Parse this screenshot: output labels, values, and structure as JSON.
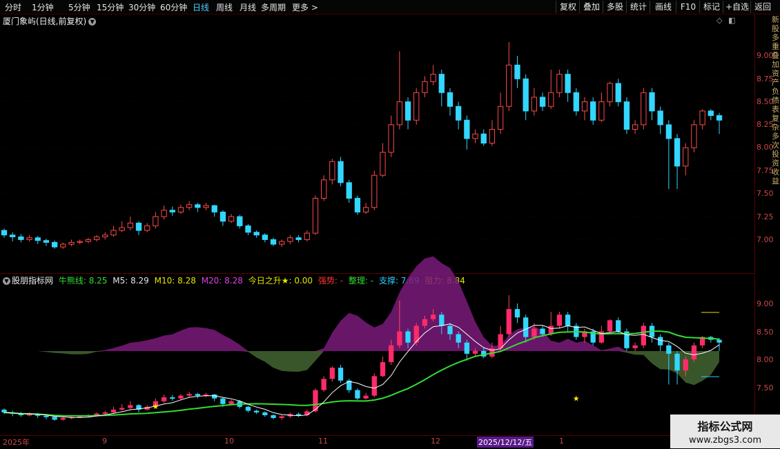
{
  "toolbar": {
    "periods": [
      "分时",
      "1分钟",
      "5分钟",
      "15分钟",
      "30分钟",
      "60分钟",
      "日线",
      "周线",
      "月线",
      "多周期",
      "更多 >"
    ],
    "active_period": "日线",
    "right_buttons": [
      "复权",
      "叠加",
      "多股",
      "统计",
      "画线",
      "F10",
      "标记",
      "+自选",
      "返回"
    ]
  },
  "main_chart": {
    "title": "厦门象屿(日线,前复权)",
    "y_ticks": [
      "9.00",
      "8.75",
      "8.50",
      "8.25",
      "8.00",
      "7.75",
      "7.50",
      "7.25",
      "7.00"
    ]
  },
  "indicator": {
    "name": "股朋指标网",
    "items": [
      {
        "label": "牛熊线: 8.25",
        "color": "#33dd33"
      },
      {
        "label": "M5: 8.29",
        "color": "#e6e6e6"
      },
      {
        "label": "M10: 8.28",
        "color": "#e6e600"
      },
      {
        "label": "M20: 8.28",
        "color": "#e040e0"
      },
      {
        "label": "今日之升★: 0.00",
        "color": "#e6e600"
      },
      {
        "label": "强势: -",
        "color": "#ff3333"
      },
      {
        "label": "整理: -",
        "color": "#33dd33"
      },
      {
        "label": "支撑: 7.69",
        "color": "#33ccff"
      },
      {
        "label": "阻力: 8.84",
        "color": "#e6e600"
      }
    ],
    "y_ticks": [
      "9.00",
      "8.50",
      "8.00",
      "7.50"
    ]
  },
  "date_axis": {
    "labels": [
      "2025年",
      "9",
      "10",
      "11",
      "12",
      "1"
    ],
    "selected": "2025/12/12/五"
  },
  "right_strip_text": "新股多重叠加资产负债表复杂多次投资收益",
  "watermark": {
    "line1": "指标公式网",
    "line2": "www.zbgs3.com"
  },
  "colors": {
    "up": "#ff4a4a",
    "down": "#33d6ff",
    "bull": "#33dd33",
    "m20": "#e040e0"
  },
  "chart_data": {
    "type": "candlestick",
    "title": "厦门象屿(日线,前复权)",
    "ylim": [
      6.85,
      9.3
    ],
    "candles": [
      [
        7.1,
        7.05,
        7.12,
        7.02
      ],
      [
        7.05,
        7.03,
        7.08,
        6.98
      ],
      [
        7.03,
        7.0,
        7.06,
        6.97
      ],
      [
        7.0,
        7.02,
        7.05,
        6.98
      ],
      [
        7.02,
        6.99,
        7.04,
        6.95
      ],
      [
        6.99,
        6.97,
        7.01,
        6.93
      ],
      [
        6.97,
        6.92,
        6.99,
        6.9
      ],
      [
        6.92,
        6.95,
        6.97,
        6.9
      ],
      [
        6.95,
        6.97,
        7.0,
        6.93
      ],
      [
        6.97,
        6.98,
        7.0,
        6.95
      ],
      [
        6.98,
        7.0,
        7.02,
        6.96
      ],
      [
        7.0,
        7.03,
        7.05,
        6.98
      ],
      [
        7.03,
        7.05,
        7.08,
        7.0
      ],
      [
        7.05,
        7.1,
        7.15,
        7.03
      ],
      [
        7.1,
        7.13,
        7.2,
        7.08
      ],
      [
        7.13,
        7.18,
        7.25,
        7.1
      ],
      [
        7.18,
        7.1,
        7.2,
        7.05
      ],
      [
        7.1,
        7.15,
        7.18,
        7.08
      ],
      [
        7.15,
        7.25,
        7.3,
        7.12
      ],
      [
        7.25,
        7.32,
        7.37,
        7.22
      ],
      [
        7.32,
        7.3,
        7.36,
        7.26
      ],
      [
        7.3,
        7.35,
        7.38,
        7.28
      ],
      [
        7.35,
        7.38,
        7.42,
        7.32
      ],
      [
        7.38,
        7.35,
        7.4,
        7.3
      ],
      [
        7.35,
        7.37,
        7.4,
        7.32
      ],
      [
        7.37,
        7.3,
        7.38,
        7.25
      ],
      [
        7.3,
        7.2,
        7.32,
        7.15
      ],
      [
        7.2,
        7.25,
        7.28,
        7.18
      ],
      [
        7.25,
        7.15,
        7.27,
        7.12
      ],
      [
        7.15,
        7.08,
        7.17,
        7.05
      ],
      [
        7.08,
        7.05,
        7.1,
        7.02
      ],
      [
        7.05,
        7.0,
        7.07,
        6.97
      ],
      [
        7.0,
        6.95,
        7.02,
        6.93
      ],
      [
        6.95,
        6.98,
        7.0,
        6.92
      ],
      [
        6.98,
        7.02,
        7.05,
        6.95
      ],
      [
        7.02,
        7.0,
        7.05,
        6.97
      ],
      [
        7.0,
        7.07,
        7.1,
        6.98
      ],
      [
        7.07,
        7.45,
        7.48,
        7.05
      ],
      [
        7.45,
        7.65,
        7.7,
        7.42
      ],
      [
        7.65,
        7.85,
        7.88,
        7.6
      ],
      [
        7.85,
        7.62,
        7.9,
        7.58
      ],
      [
        7.62,
        7.45,
        7.65,
        7.4
      ],
      [
        7.45,
        7.3,
        7.48,
        7.27
      ],
      [
        7.3,
        7.35,
        7.4,
        7.28
      ],
      [
        7.35,
        7.7,
        7.75,
        7.32
      ],
      [
        7.7,
        7.95,
        8.05,
        7.68
      ],
      [
        7.95,
        8.25,
        8.35,
        7.9
      ],
      [
        8.25,
        8.5,
        9.05,
        8.2
      ],
      [
        8.5,
        8.3,
        8.55,
        8.2
      ],
      [
        8.3,
        8.6,
        8.65,
        8.25
      ],
      [
        8.6,
        8.72,
        8.78,
        8.55
      ],
      [
        8.72,
        8.8,
        8.9,
        8.68
      ],
      [
        8.8,
        8.6,
        8.85,
        8.45
      ],
      [
        8.6,
        8.45,
        8.65,
        8.35
      ],
      [
        8.45,
        8.3,
        8.5,
        8.2
      ],
      [
        8.3,
        8.1,
        8.35,
        7.98
      ],
      [
        8.1,
        8.15,
        8.2,
        8.05
      ],
      [
        8.15,
        8.05,
        8.2,
        8.02
      ],
      [
        8.05,
        8.2,
        8.3,
        8.02
      ],
      [
        8.2,
        8.45,
        8.6,
        8.15
      ],
      [
        8.45,
        8.9,
        9.15,
        8.4
      ],
      [
        8.9,
        8.75,
        9.0,
        8.65
      ],
      [
        8.75,
        8.4,
        8.8,
        8.3
      ],
      [
        8.4,
        8.55,
        8.65,
        8.35
      ],
      [
        8.55,
        8.45,
        8.6,
        8.4
      ],
      [
        8.45,
        8.6,
        8.85,
        8.42
      ],
      [
        8.6,
        8.8,
        8.85,
        8.55
      ],
      [
        8.8,
        8.6,
        8.85,
        8.5
      ],
      [
        8.6,
        8.4,
        8.65,
        8.35
      ],
      [
        8.4,
        8.5,
        8.55,
        8.3
      ],
      [
        8.5,
        8.3,
        8.55,
        8.25
      ],
      [
        8.3,
        8.5,
        8.6,
        8.28
      ],
      [
        8.5,
        8.7,
        8.72,
        8.45
      ],
      [
        8.7,
        8.5,
        8.75,
        8.45
      ],
      [
        8.5,
        8.2,
        8.55,
        8.15
      ],
      [
        8.2,
        8.25,
        8.3,
        8.15
      ],
      [
        8.25,
        8.6,
        8.65,
        8.2
      ],
      [
        8.6,
        8.4,
        8.65,
        8.3
      ],
      [
        8.4,
        8.25,
        8.45,
        8.15
      ],
      [
        8.25,
        8.1,
        8.3,
        7.55
      ],
      [
        8.1,
        7.8,
        8.15,
        7.55
      ],
      [
        7.8,
        8.0,
        8.05,
        7.7
      ],
      [
        8.0,
        8.25,
        8.3,
        7.95
      ],
      [
        8.25,
        8.4,
        8.42,
        8.2
      ],
      [
        8.4,
        8.35,
        8.42,
        8.3
      ],
      [
        8.35,
        8.3,
        8.38,
        8.15
      ]
    ]
  }
}
